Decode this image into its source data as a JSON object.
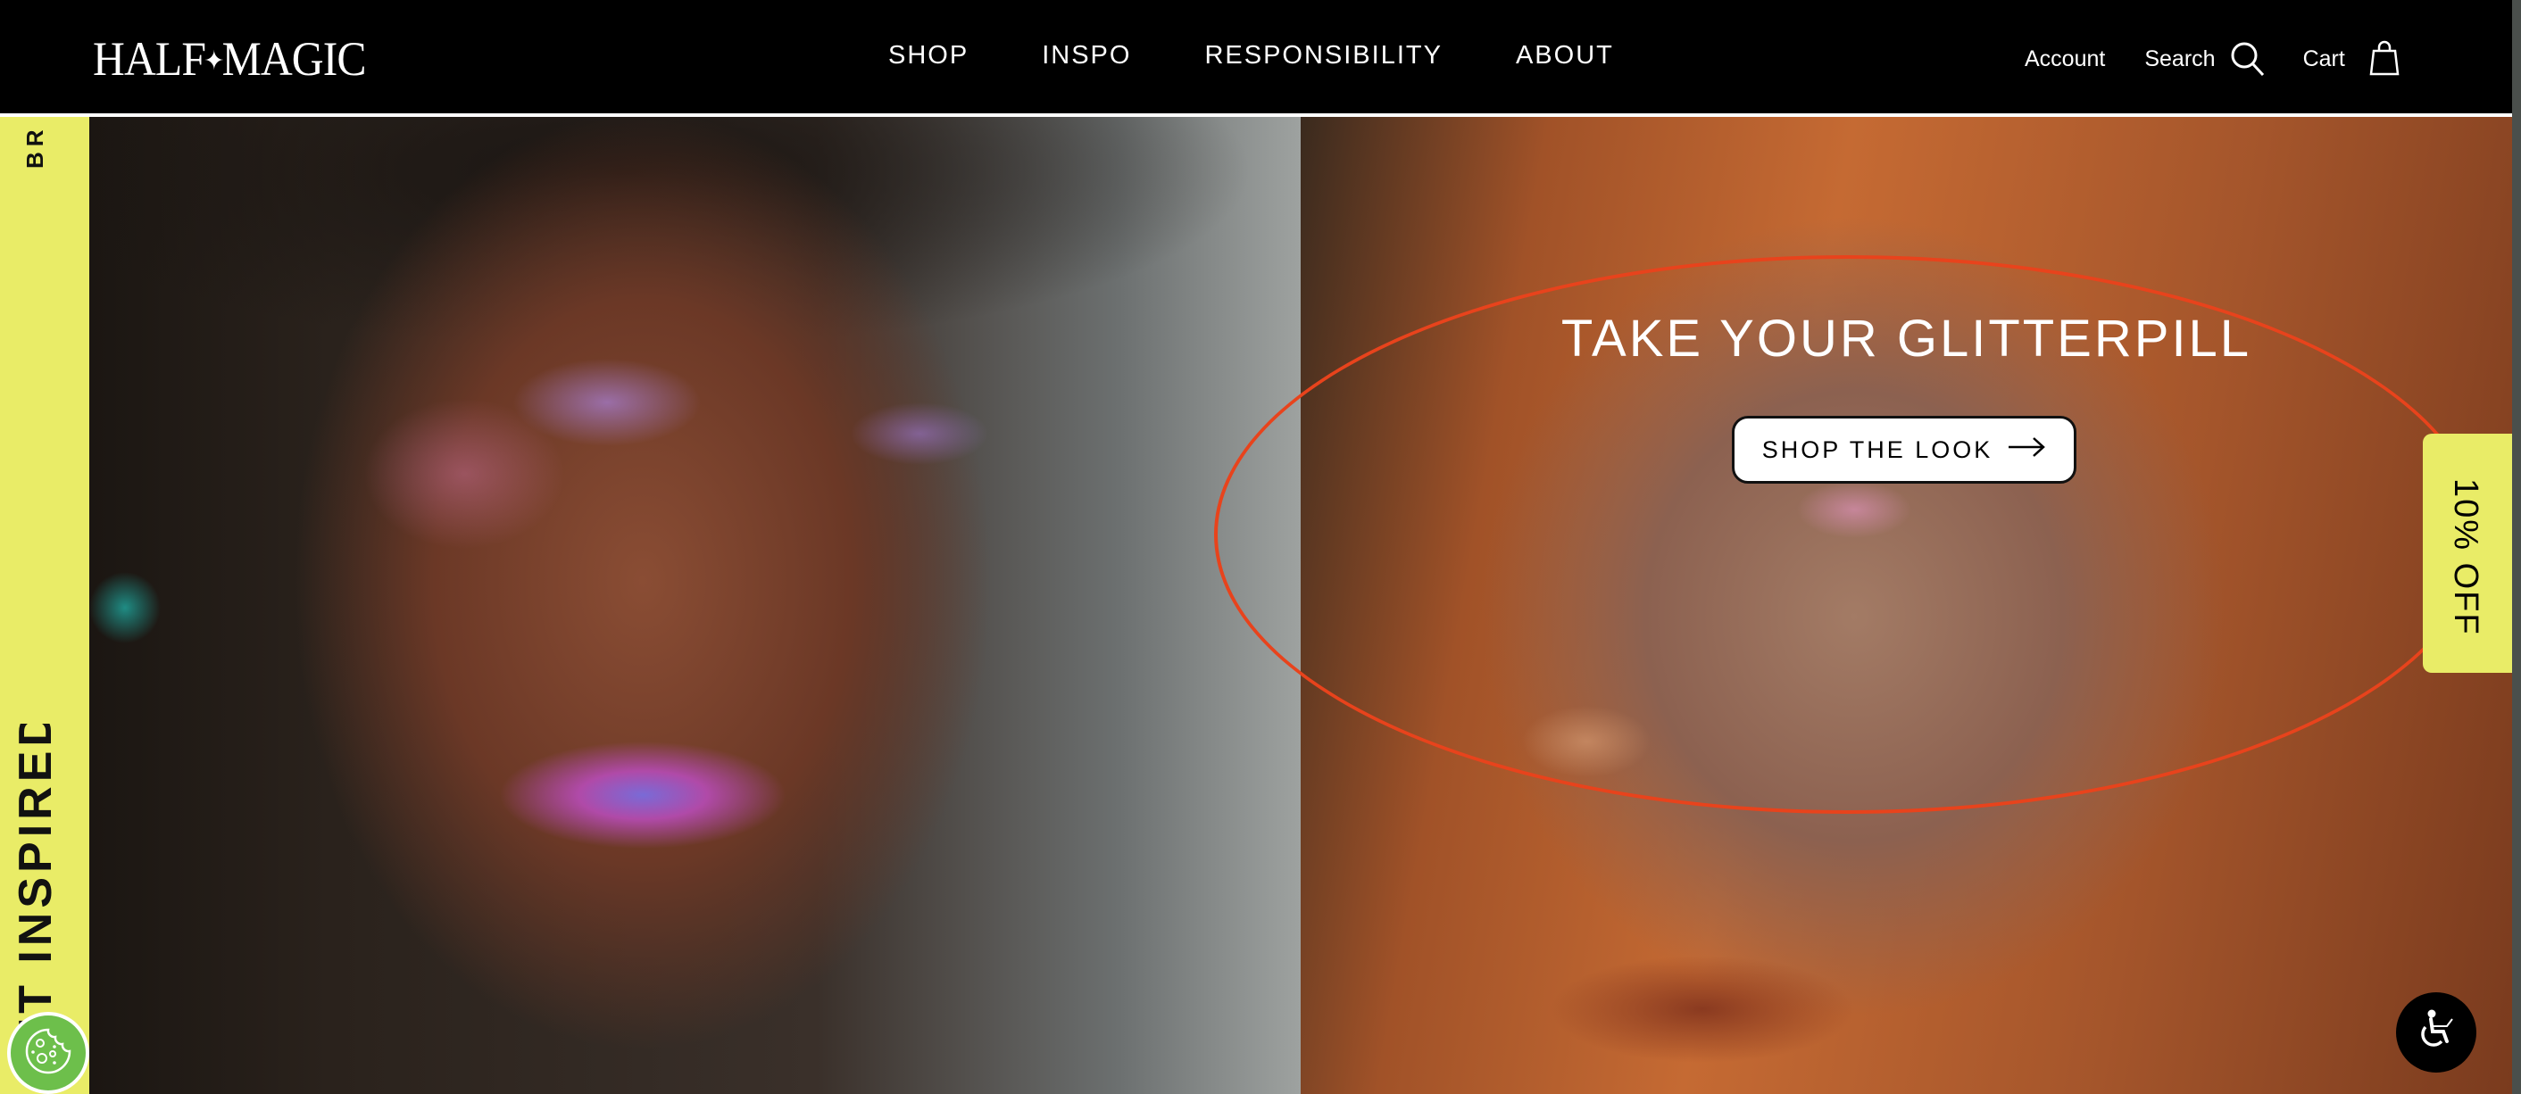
{
  "header": {
    "logo": {
      "left": "HALF",
      "spark": "✦",
      "right": "MAGIC"
    },
    "nav": [
      "SHOP",
      "INSPO",
      "RESPONSIBILITY",
      "ABOUT"
    ],
    "utilities": {
      "account_label": "Account",
      "search_label": "Search",
      "cart_label": "Cart"
    }
  },
  "sidebar": {
    "top_text": "BR",
    "bottom_text": "GET INSPIRED"
  },
  "hero": {
    "title": "TAKE YOUR GLITTERPILL",
    "cta_label": "SHOP THE LOOK",
    "cta_arrow": "→"
  },
  "promo_tab": {
    "label": "10% OFF"
  },
  "widgets": {
    "cookie_icon": "cookie-icon",
    "accessibility_icon": "accessibility-icon"
  },
  "colors": {
    "accent_yellow": "#e9ec67",
    "header_bg": "#000000",
    "annotation_red": "#e8431c",
    "cookie_green": "#6dbf4b"
  }
}
